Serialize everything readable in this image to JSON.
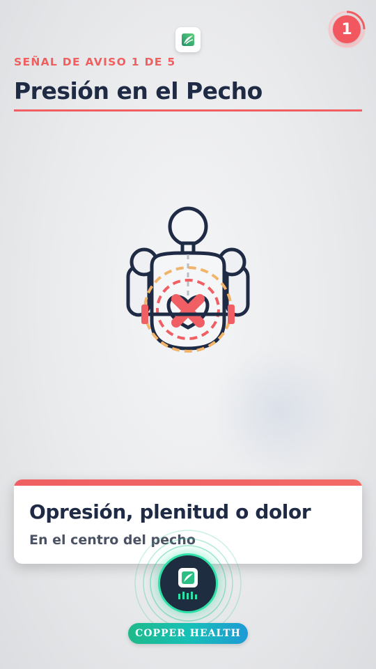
{
  "header": {
    "eyebrow": "SEÑAL DE AVISO 1 DE 5",
    "title": "Presión en el Pecho",
    "counter": "1",
    "logo_icon": "leaf-logo-icon"
  },
  "illustration": {
    "icon": "chest-pressure-figure-icon",
    "colors": {
      "outline": "#1f2a44",
      "pressure": "#ef5f63",
      "ring_outer": "#f2b36a",
      "ring_inner": "#ef5f63"
    }
  },
  "card": {
    "title": "Opresión, plenitud o dolor",
    "subtitle": "En el centro del pecho"
  },
  "brand": {
    "name": "COPPER HEALTH",
    "button_icon": "leaf-logo-icon"
  },
  "colors": {
    "accent": "#ef5f63",
    "text_dark": "#1f2a44",
    "brand_green": "#2fe0a7",
    "brand_blue": "#1e9ad6"
  }
}
